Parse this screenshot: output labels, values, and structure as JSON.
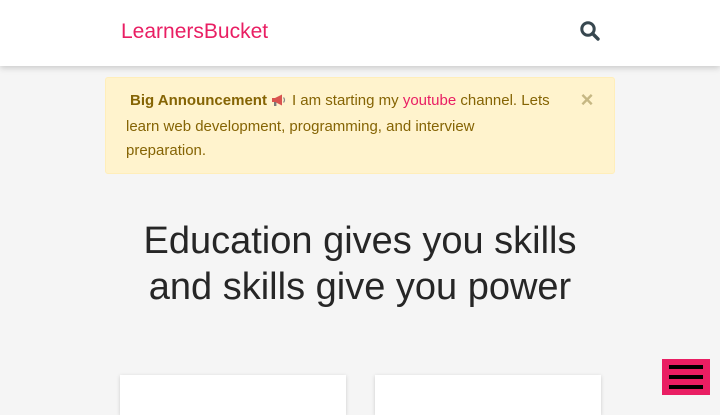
{
  "header": {
    "logo": "LearnersBucket",
    "search_icon": "search-icon"
  },
  "announcement": {
    "title": "Big Announcement",
    "icon": "megaphone-icon",
    "text_before_link": "I am starting my",
    "link_text": "youtube",
    "text_after_link": "channel. Lets learn web development, programming, and interview preparation.",
    "close_label": "×"
  },
  "hero": {
    "line1": "Education gives you skills",
    "line2": "and skills give you power"
  },
  "menu": {
    "icon": "hamburger-menu-icon"
  },
  "colors": {
    "brand": "#e91e63",
    "alert_bg": "#fff3cd",
    "alert_text": "#856404"
  }
}
